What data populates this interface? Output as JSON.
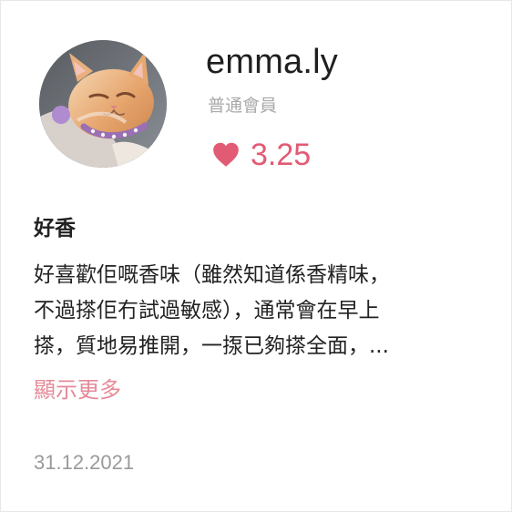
{
  "user": {
    "avatar_icon": "cat-photo-avatar",
    "username": "emma.ly",
    "member_level": "普通會員",
    "rating": {
      "icon": "heart-icon",
      "value": "3.25",
      "color": "#e25b74"
    }
  },
  "review": {
    "title": "好香",
    "body_lines": [
      "好喜歡佢嘅香味（雖然知道係香精味，",
      "不過搽佢冇試過敏感），通常會在早上",
      "搽，質地易推開，一揼已夠搽全面，..."
    ],
    "show_more_label": "顯示更多",
    "date": "31.12.2021"
  },
  "colors": {
    "accent_pink": "#e25b74",
    "show_more_pink": "#e58a98",
    "secondary_gray": "#a9a9a9",
    "date_gray": "#9a9a9a"
  }
}
